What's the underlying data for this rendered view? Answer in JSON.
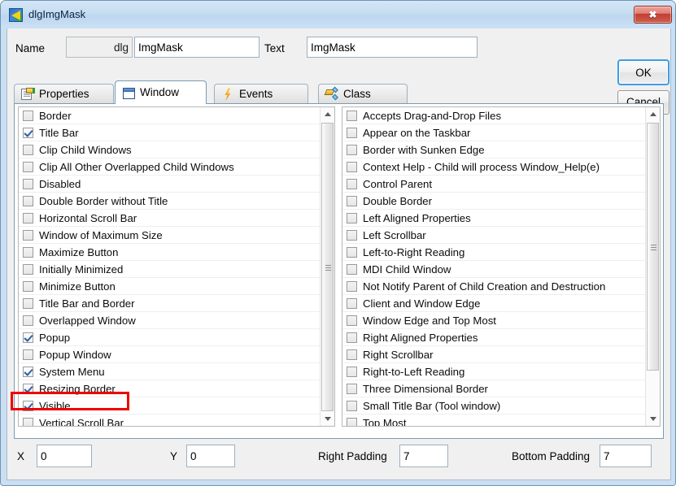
{
  "window": {
    "title": "dlgImgMask",
    "icon": "app-arrow-icon",
    "close_label": "✖"
  },
  "form": {
    "name_label": "Name",
    "name_prefix": "dlg",
    "name_value": "ImgMask",
    "text_label": "Text",
    "text_value": "ImgMask"
  },
  "buttons": {
    "ok": "OK",
    "cancel": "Cancel"
  },
  "tabs": [
    {
      "label": "Properties",
      "icon": "properties-document-icon",
      "active": false
    },
    {
      "label": "Window",
      "icon": "window-box-icon",
      "active": true
    },
    {
      "label": "Events",
      "icon": "lightning-bolt-icon",
      "active": false
    },
    {
      "label": "Class",
      "icon": "class-diamond-icon",
      "active": false
    }
  ],
  "left_list": [
    {
      "label": "Border",
      "checked": false
    },
    {
      "label": "Title Bar",
      "checked": true
    },
    {
      "label": "Clip Child Windows",
      "checked": false
    },
    {
      "label": "Clip All Other Overlapped Child Windows",
      "checked": false
    },
    {
      "label": "Disabled",
      "checked": false
    },
    {
      "label": "Double Border without Title",
      "checked": false
    },
    {
      "label": "Horizontal Scroll Bar",
      "checked": false
    },
    {
      "label": "Window of Maximum Size",
      "checked": false
    },
    {
      "label": "Maximize Button",
      "checked": false
    },
    {
      "label": "Initially Minimized",
      "checked": false
    },
    {
      "label": "Minimize Button",
      "checked": false
    },
    {
      "label": "Title Bar and Border",
      "checked": false
    },
    {
      "label": "Overlapped Window",
      "checked": false
    },
    {
      "label": "Popup",
      "checked": true
    },
    {
      "label": "Popup Window",
      "checked": false
    },
    {
      "label": "System Menu",
      "checked": true
    },
    {
      "label": "Resizing Border",
      "checked": true,
      "highlighted": true
    },
    {
      "label": "Visible",
      "checked": true
    },
    {
      "label": "Vertical Scroll Bar",
      "checked": false
    }
  ],
  "right_list": [
    {
      "label": "Accepts Drag-and-Drop Files",
      "checked": false
    },
    {
      "label": "Appear on the Taskbar",
      "checked": false
    },
    {
      "label": "Border with Sunken Edge",
      "checked": false
    },
    {
      "label": "Context Help - Child will process Window_Help(e)",
      "checked": false
    },
    {
      "label": "Control Parent",
      "checked": false
    },
    {
      "label": "Double Border",
      "checked": false
    },
    {
      "label": "Left Aligned Properties",
      "checked": false
    },
    {
      "label": "Left Scrollbar",
      "checked": false
    },
    {
      "label": "Left-to-Right Reading",
      "checked": false
    },
    {
      "label": "MDI Child Window",
      "checked": false
    },
    {
      "label": "Not Notify Parent of Child Creation and Destruction",
      "checked": false
    },
    {
      "label": "Client and Window Edge",
      "checked": false
    },
    {
      "label": "Window Edge and Top Most",
      "checked": false
    },
    {
      "label": "Right Aligned Properties",
      "checked": false
    },
    {
      "label": "Right Scrollbar",
      "checked": false
    },
    {
      "label": "Right-to-Left Reading",
      "checked": false
    },
    {
      "label": "Three Dimensional Border",
      "checked": false
    },
    {
      "label": "Small Title Bar (Tool window)",
      "checked": false
    },
    {
      "label": "Top Most",
      "checked": false
    }
  ],
  "bottom": {
    "x_label": "X",
    "x_value": "0",
    "y_label": "Y",
    "y_value": "0",
    "right_padding_label": "Right Padding",
    "right_padding_value": "7",
    "bottom_padding_label": "Bottom Padding",
    "bottom_padding_value": "7"
  },
  "colors": {
    "accent": "#3c9fe0",
    "highlight": "#ee0000",
    "close": "#c23e30",
    "titlebar": "#cbdff1"
  }
}
